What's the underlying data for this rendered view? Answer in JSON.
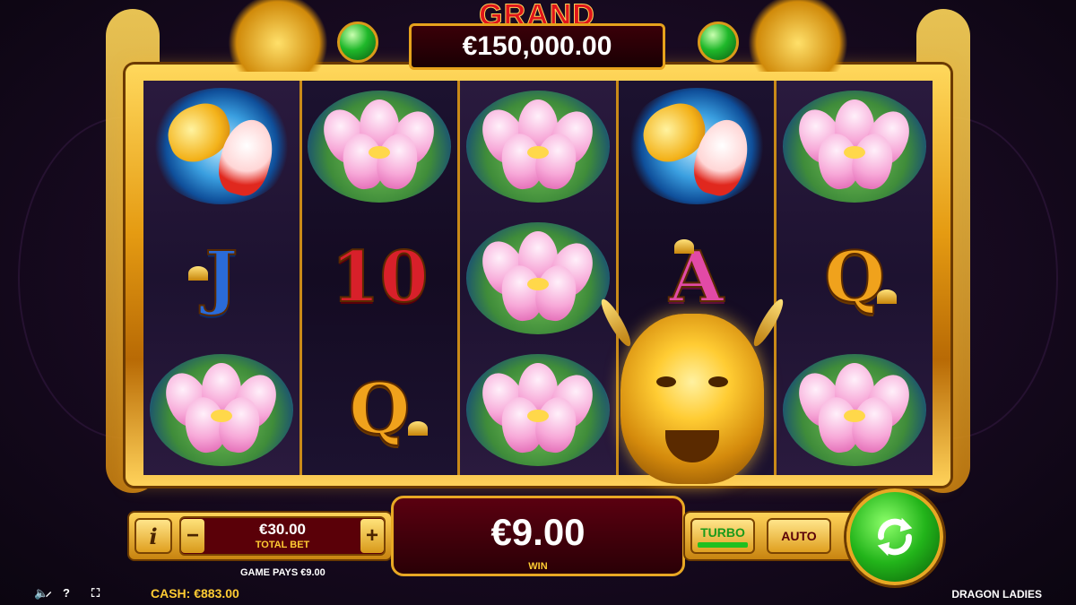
{
  "jackpot": {
    "label": "GRAND",
    "value": "€150,000.00"
  },
  "reels": [
    [
      "koi",
      "J",
      "lotus"
    ],
    [
      "lotus",
      "10",
      "Q"
    ],
    [
      "lotus",
      "lotus",
      "lotus"
    ],
    [
      "koi",
      "A",
      "dragon"
    ],
    [
      "lotus",
      "Q",
      "lotus"
    ]
  ],
  "controls": {
    "info_label": "i",
    "minus_label": "−",
    "plus_label": "+",
    "total_bet_value": "€30.00",
    "total_bet_label": "TOTAL BET",
    "game_pays": "GAME PAYS €9.00",
    "win_value": "€9.00",
    "win_label": "WIN",
    "turbo_label": "TURBO",
    "auto_label": "AUTO"
  },
  "footer": {
    "cash_label": "CASH:",
    "cash_value": "€883.00",
    "game_name": "DRAGON LADIES",
    "icons": [
      "sound-off-icon",
      "help-icon",
      "fullscreen-icon"
    ]
  },
  "colors": {
    "gold": "#e8a824",
    "win_panel": "#5a0010",
    "spin_green": "#22b41a",
    "grand_red": "#e0141a"
  }
}
